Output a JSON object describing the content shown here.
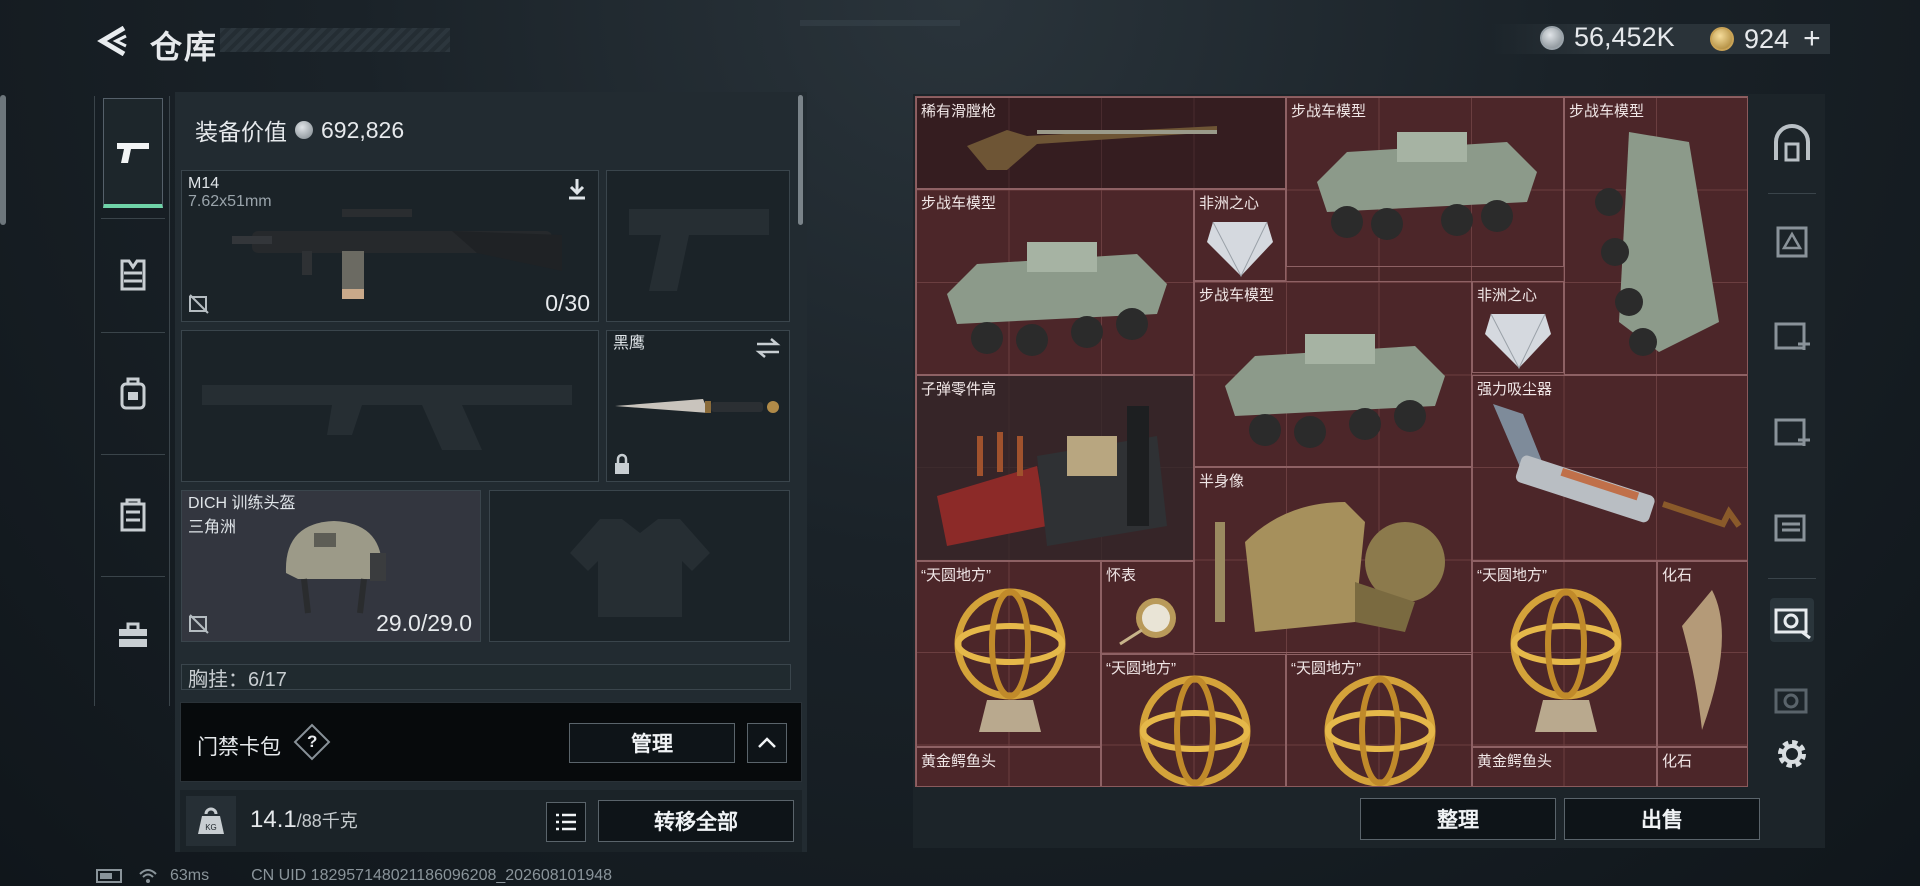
{
  "header": {
    "title": "仓库"
  },
  "currency": {
    "silver": "56,452K",
    "gold": "924",
    "add_label": "+"
  },
  "left_nav": [
    {
      "icon": "pistol-icon",
      "active": true
    },
    {
      "icon": "armor-vest-icon"
    },
    {
      "icon": "backpack-icon"
    },
    {
      "icon": "chest-rig-icon"
    },
    {
      "icon": "toolbox-icon"
    }
  ],
  "loadout": {
    "value_label": "装备价值",
    "value": "692,826",
    "primary": {
      "name": "M14",
      "caliber": "7.62x51mm",
      "ammo": "0/30"
    },
    "knife": {
      "name": "黑鹰"
    },
    "helmet": {
      "name": "DICH 训练头盔",
      "faction": "三角洲",
      "durability": "29.0/29.0"
    },
    "chest_partial": "胸挂：6/17"
  },
  "keycard": {
    "label": "门禁卡包",
    "help": "?",
    "manage": "管理"
  },
  "weight": {
    "current": "14.1",
    "max": "/88千克",
    "transfer_all": "转移全部",
    "kg": "KG"
  },
  "stash_items": [
    {
      "name": "稀有滑膛枪"
    },
    {
      "name": "步战车模型"
    },
    {
      "name": "步战车模型"
    },
    {
      "name": "步战车模型"
    },
    {
      "name": "非洲之心"
    },
    {
      "name": "步战车模型"
    },
    {
      "name": "非洲之心"
    },
    {
      "name": "子弹零件高"
    },
    {
      "name": "强力吸尘器"
    },
    {
      "name": "半身像"
    },
    {
      "name": "“天圆地方”"
    },
    {
      "name": "怀表"
    },
    {
      "name": "“天圆地方”"
    },
    {
      "name": "化石"
    },
    {
      "name": "“天圆地方”"
    },
    {
      "name": "“天圆地方”"
    },
    {
      "name": "黄金鳄鱼头"
    },
    {
      "name": "黄金鳄鱼头"
    },
    {
      "name": "化石"
    }
  ],
  "stash_buttons": {
    "sort": "整理",
    "sell": "出售"
  },
  "right_tools": [
    "safe-box-icon",
    "gift-stash-icon",
    "stash-iv-icon",
    "stash-iv-icon",
    "stash-iv-icon",
    "stash-v-icon",
    "stash-v-icon",
    "settings-icon"
  ],
  "status": {
    "ping": "63ms",
    "uid": "CN UID 182957148021186096208_202608101948"
  }
}
